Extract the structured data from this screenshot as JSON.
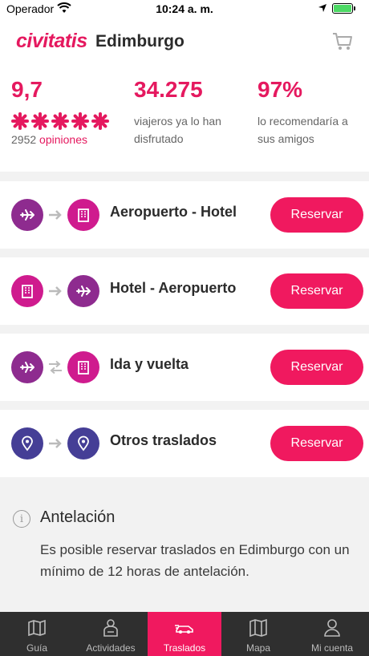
{
  "status_bar": {
    "carrier": "Operador",
    "time": "10:24 a. m."
  },
  "header": {
    "logo": "civitatis",
    "city": "Edimburgo"
  },
  "stats": {
    "rating": "9,7",
    "opinions_count": "2952",
    "opinions_label": "opiniones",
    "travelers": "34.275",
    "travelers_text": "viajeros ya lo han disfrutado",
    "recommend": "97%",
    "recommend_text": "lo recomendaría a sus amigos"
  },
  "transfers": [
    {
      "title": "Aeropuerto - Hotel",
      "button": "Reservar"
    },
    {
      "title": "Hotel - Aeropuerto",
      "button": "Reservar"
    },
    {
      "title": "Ida y vuelta",
      "button": "Reservar"
    },
    {
      "title": "Otros traslados",
      "button": "Reservar"
    }
  ],
  "info": {
    "title": "Antelación",
    "text": "Es posible reservar traslados en Edimburgo con un mínimo de 12 horas de antelación."
  },
  "tabbar": [
    {
      "label": "Guía",
      "icon": "map-pin-icon"
    },
    {
      "label": "Actividades",
      "icon": "person-icon"
    },
    {
      "label": "Traslados",
      "icon": "car-icon",
      "active": true
    },
    {
      "label": "Mapa",
      "icon": "map-icon"
    },
    {
      "label": "Mi cuenta",
      "icon": "user-icon"
    }
  ],
  "colors": {
    "brand": "#e5195f",
    "button": "#f0195f",
    "purple": "#8e2b8f",
    "magenta": "#cf1b8e",
    "indigo": "#453e96"
  }
}
